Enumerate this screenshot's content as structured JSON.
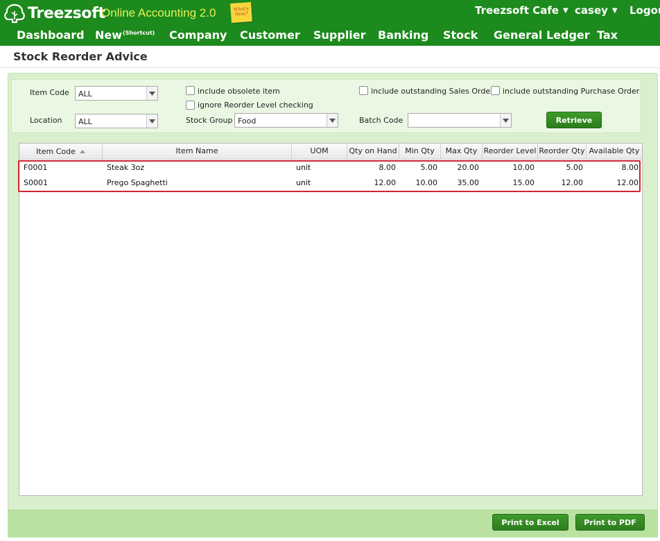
{
  "header": {
    "logo_text": "Treezsoft",
    "app_name": "Online Accounting 2.0",
    "whats_new": "What's New?",
    "company": "Treezsoft Cafe",
    "user": "casey",
    "logout": "Logout"
  },
  "nav": {
    "items": [
      {
        "label": "Dashboard"
      },
      {
        "label": "New",
        "sup": "(Shortcut)"
      },
      {
        "label": "Company"
      },
      {
        "label": "Customer"
      },
      {
        "label": "Supplier"
      },
      {
        "label": "Banking"
      },
      {
        "label": "Stock"
      },
      {
        "label": "General Ledger"
      },
      {
        "label": "Tax"
      }
    ]
  },
  "page": {
    "title": "Stock Reorder Advice"
  },
  "filters": {
    "item_code_label": "Item Code",
    "item_code_value": "ALL",
    "location_label": "Location",
    "location_value": "ALL",
    "include_obsolete_label": "include obsolete item",
    "ignore_reorder_label": "ignore Reorder Level checking",
    "stock_group_label": "Stock Group",
    "stock_group_value": "Food",
    "include_sales_order_label": "include outstanding Sales Order",
    "include_purchase_order_label": "include outstanding Purchase Order",
    "batch_code_label": "Batch Code",
    "batch_code_value": "",
    "retrieve_label": "Retrieve"
  },
  "table": {
    "columns": [
      "Item Code",
      "Item Name",
      "UOM",
      "Qty on Hand",
      "Min Qty",
      "Max Qty",
      "Reorder Level",
      "Reorder Qty",
      "Available Qty"
    ],
    "sorted_column": "Item Code",
    "rows": [
      {
        "item_code": "F0001",
        "item_name": "Steak 3oz",
        "uom": "unit",
        "qty_on_hand": "8.00",
        "min_qty": "5.00",
        "max_qty": "20.00",
        "reorder_level": "10.00",
        "reorder_qty": "5.00",
        "available_qty": "8.00"
      },
      {
        "item_code": "S0001",
        "item_name": "Prego Spaghetti",
        "uom": "unit",
        "qty_on_hand": "12.00",
        "min_qty": "10.00",
        "max_qty": "35.00",
        "reorder_level": "15.00",
        "reorder_qty": "12.00",
        "available_qty": "12.00"
      }
    ]
  },
  "footer": {
    "print_excel_label": "Print to Excel",
    "print_pdf_label": "Print to PDF"
  },
  "colors": {
    "header_bg": "#1c8a1c",
    "app_name": "#e8f05a",
    "button_green": "#2c7c1c",
    "panel_bg": "#d9efcd",
    "highlight_border": "#d0232f"
  }
}
